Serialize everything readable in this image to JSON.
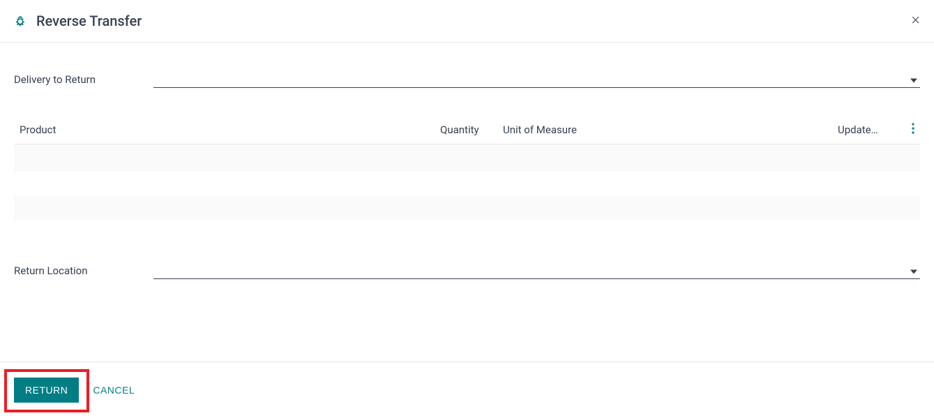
{
  "modal": {
    "title": "Reverse Transfer"
  },
  "form": {
    "delivery_label": "Delivery to Return",
    "delivery_value": "",
    "return_location_label": "Return Location",
    "return_location_value": ""
  },
  "table": {
    "headers": {
      "product": "Product",
      "quantity": "Quantity",
      "unit": "Unit of Measure",
      "update": "Update…"
    }
  },
  "footer": {
    "return_label": "RETURN",
    "cancel_label": "CANCEL"
  }
}
